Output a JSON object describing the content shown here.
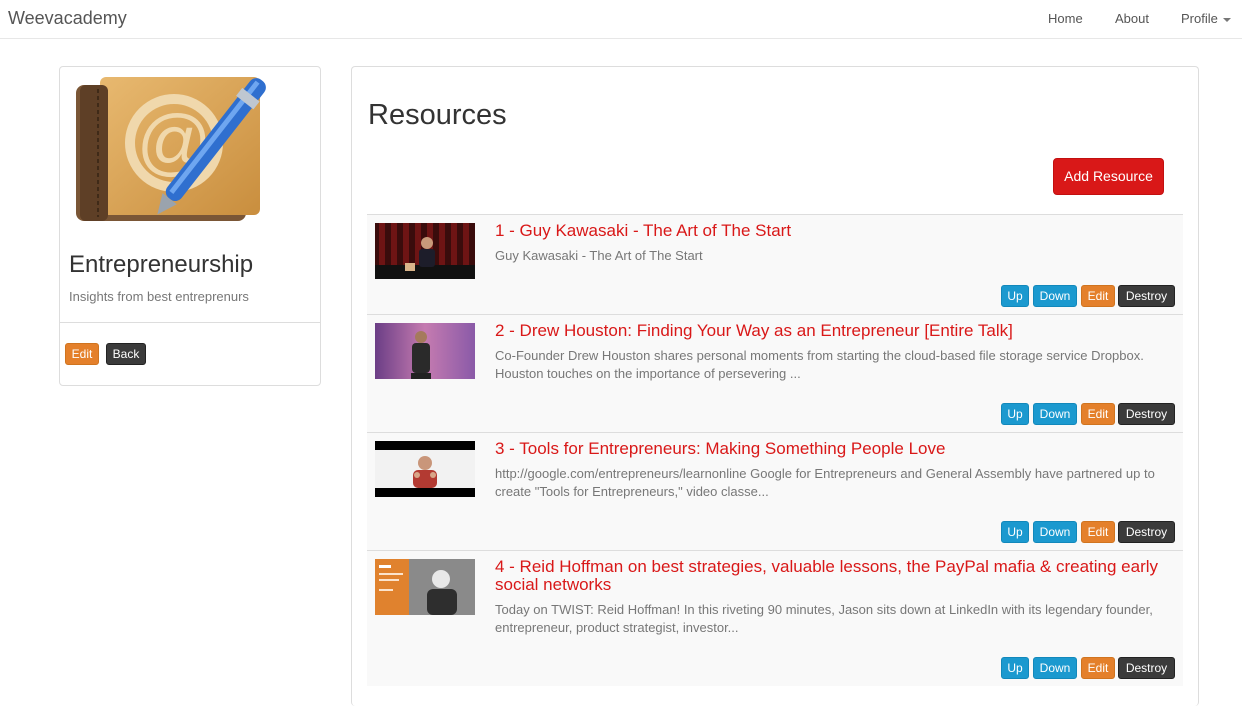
{
  "navbar": {
    "brand": "Weevacademy",
    "links": {
      "home": "Home",
      "about": "About",
      "profile": "Profile"
    }
  },
  "course": {
    "title": "Entrepreneurship",
    "subtitle": "Insights from best entreprenurs",
    "edit_label": "Edit",
    "back_label": "Back"
  },
  "main": {
    "heading": "Resources",
    "add_label": "Add Resource"
  },
  "actions": {
    "up": "Up",
    "down": "Down",
    "edit": "Edit",
    "destroy": "Destroy"
  },
  "resources": [
    {
      "title": "1 - Guy Kawasaki - The Art of The Start",
      "description": "Guy Kawasaki - The Art of The Start"
    },
    {
      "title": "2 - Drew Houston: Finding Your Way as an Entrepreneur [Entire Talk]",
      "description": "Co-Founder Drew Houston shares personal moments from starting the cloud-based file storage service Dropbox. Houston touches on the importance of persevering ..."
    },
    {
      "title": "3 - Tools for Entrepreneurs: Making Something People Love",
      "description": "http://google.com/entrepreneurs/learnonline Google for Entrepreneurs and General Assembly have partnered up to create \"Tools for Entrepreneurs,\" video classe..."
    },
    {
      "title": "4 - Reid Hoffman on best strategies, valuable lessons, the PayPal mafia & creating early social networks",
      "description": "Today on TWIST: Reid Hoffman! In this riveting 90 minutes, Jason sits down at LinkedIn with its legendary founder, entrepreneur, product strategist, investor..."
    }
  ],
  "icons": {
    "course_image": "address-book-icon",
    "thumbnails": "video-thumbnail"
  },
  "colors": {
    "accent_red": "#d91818",
    "edit_orange": "#e4802b",
    "info_blue": "#1b99cf",
    "dark": "#3b3b3b"
  }
}
